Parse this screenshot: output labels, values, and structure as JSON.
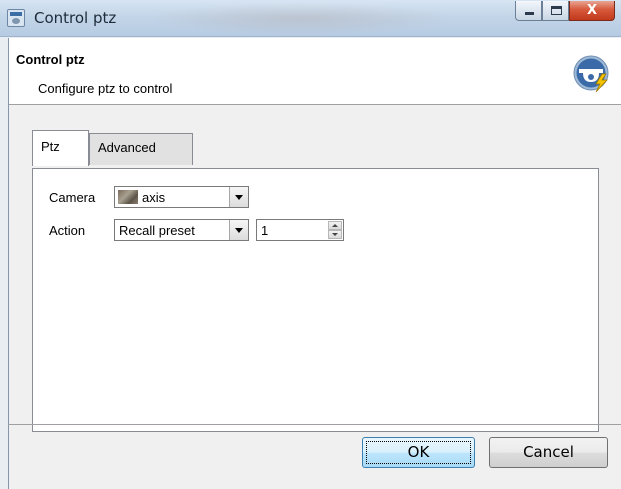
{
  "window": {
    "title": "Control ptz",
    "icon": "app-icon",
    "caption_buttons": {
      "minimize": "minimize-icon",
      "maximize": "maximize-icon",
      "close_glyph": "X"
    }
  },
  "header": {
    "title": "Control ptz",
    "subtitle": "Configure ptz to control",
    "icon": "ptz-camera-lightning-icon"
  },
  "tabs": [
    {
      "label": "Ptz",
      "active": true
    },
    {
      "label": "Advanced",
      "active": false
    }
  ],
  "form": {
    "camera": {
      "label": "Camera",
      "value": "axis",
      "thumbnail": "camera-thumbnail"
    },
    "action": {
      "label": "Action",
      "value": "Recall preset",
      "preset_number": "1"
    }
  },
  "buttons": {
    "ok": "OK",
    "cancel": "Cancel"
  },
  "colors": {
    "accent_blue": "#3c7fb1",
    "icon_blue": "#2f5f9a",
    "lightning_yellow": "#f5c400"
  }
}
